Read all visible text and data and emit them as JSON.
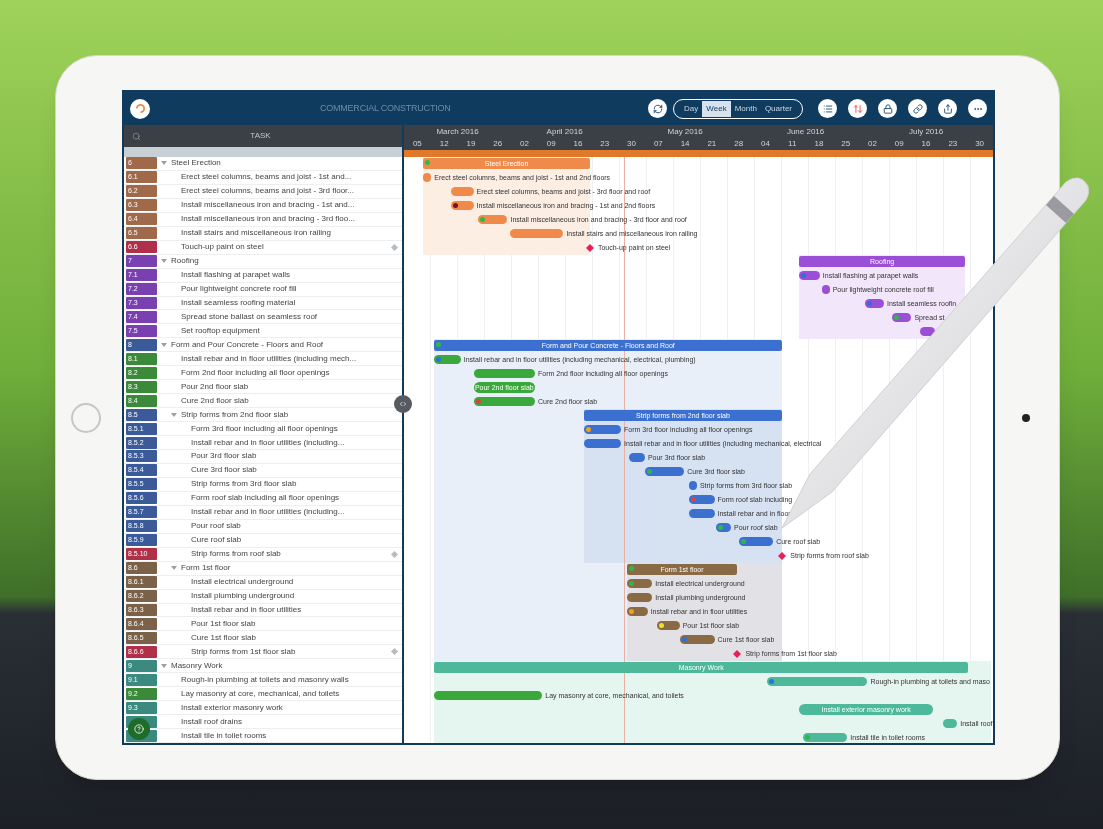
{
  "header": {
    "title": "COMMERCIAL CONSTRUCTION",
    "views": [
      {
        "label": "Day",
        "selected": false
      },
      {
        "label": "Week",
        "selected": true
      },
      {
        "label": "Month",
        "selected": false
      },
      {
        "label": "Quarter",
        "selected": false
      }
    ]
  },
  "task_panel": {
    "heading": "TASK"
  },
  "timeline": {
    "months": [
      "March 2016",
      "April 2016",
      "May 2016",
      "June 2016",
      "July 2016"
    ],
    "days": [
      "05",
      "12",
      "19",
      "26",
      "02",
      "09",
      "16",
      "23",
      "30",
      "07",
      "14",
      "21",
      "28",
      "04",
      "11",
      "18",
      "25",
      "02",
      "09",
      "16",
      "23",
      "30"
    ]
  },
  "tasks": [
    {
      "kind": "group",
      "code": "6",
      "name": "Steel Erection",
      "color": "#a0694a",
      "expanded": true,
      "children": [
        {
          "kind": "task",
          "code": "6.1",
          "name": "Erect steel columns, beams and joist - 1st and...",
          "color": "#a0694a"
        },
        {
          "kind": "task",
          "code": "6.2",
          "name": "Erect steel columns, beams and joist - 3rd floor...",
          "color": "#a0694a"
        },
        {
          "kind": "task",
          "code": "6.3",
          "name": "Install miscellaneous iron and bracing - 1st and...",
          "color": "#a0694a"
        },
        {
          "kind": "task",
          "code": "6.4",
          "name": "Install miscellaneous iron and bracing - 3rd floo...",
          "color": "#a0694a"
        },
        {
          "kind": "task",
          "code": "6.5",
          "name": "Install stairs and miscellaneous iron railing",
          "color": "#a0694a"
        },
        {
          "kind": "milestone",
          "code": "6.6",
          "name": "Touch-up paint on steel",
          "color": "#b0304a"
        }
      ]
    },
    {
      "kind": "group",
      "code": "7",
      "name": "Roofing",
      "color": "#7a3fb0",
      "expanded": true,
      "children": [
        {
          "kind": "task",
          "code": "7.1",
          "name": "Install flashing at parapet walls",
          "color": "#7a3fb0"
        },
        {
          "kind": "task",
          "code": "7.2",
          "name": "Pour lightweight concrete roof fill",
          "color": "#7a3fb0"
        },
        {
          "kind": "task",
          "code": "7.3",
          "name": "Install seamless roofing material",
          "color": "#7a3fb0"
        },
        {
          "kind": "task",
          "code": "7.4",
          "name": "Spread stone ballast on seamless roof",
          "color": "#7a3fb0"
        },
        {
          "kind": "task",
          "code": "7.5",
          "name": "Set rooftop equipment",
          "color": "#7a3fb0"
        }
      ]
    },
    {
      "kind": "group",
      "code": "8",
      "name": "Form and Pour Concrete - Floors and Roof",
      "color": "#3a5a9a",
      "expanded": true,
      "children": [
        {
          "kind": "task",
          "code": "8.1",
          "name": "Install rebar and in floor utilities (including mech...",
          "color": "#3a8a3a"
        },
        {
          "kind": "task",
          "code": "8.2",
          "name": "Form 2nd floor including all floor openings",
          "color": "#3a8a3a"
        },
        {
          "kind": "task",
          "code": "8.3",
          "name": "Pour 2nd floor slab",
          "color": "#3a8a3a"
        },
        {
          "kind": "task",
          "code": "8.4",
          "name": "Cure 2nd floor slab",
          "color": "#3a8a3a"
        },
        {
          "kind": "group",
          "code": "8.5",
          "name": "Strip forms from 2nd floor slab",
          "color": "#3a5a9a",
          "expanded": true,
          "children": [
            {
              "kind": "task",
              "code": "8.5.1",
              "name": "Form 3rd floor including all floor openings",
              "color": "#3a5a9a"
            },
            {
              "kind": "task",
              "code": "8.5.2",
              "name": "Install rebar and in floor utilities (including...",
              "color": "#3a5a9a"
            },
            {
              "kind": "task",
              "code": "8.5.3",
              "name": "Pour 3rd floor slab",
              "color": "#3a5a9a"
            },
            {
              "kind": "task",
              "code": "8.5.4",
              "name": "Cure 3rd floor slab",
              "color": "#3a5a9a"
            },
            {
              "kind": "task",
              "code": "8.5.5",
              "name": "Strip forms from 3rd floor slab",
              "color": "#3a5a9a"
            },
            {
              "kind": "task",
              "code": "8.5.6",
              "name": "Form roof slab including all floor openings",
              "color": "#3a5a9a"
            },
            {
              "kind": "task",
              "code": "8.5.7",
              "name": "Install rebar and in floor utilities (including...",
              "color": "#3a5a9a"
            },
            {
              "kind": "task",
              "code": "8.5.8",
              "name": "Pour roof slab",
              "color": "#3a5a9a"
            },
            {
              "kind": "task",
              "code": "8.5.9",
              "name": "Cure roof slab",
              "color": "#3a5a9a"
            },
            {
              "kind": "milestone",
              "code": "8.5.10",
              "name": "Strip forms from roof slab",
              "color": "#b0304a"
            }
          ]
        },
        {
          "kind": "group",
          "code": "8.6",
          "name": "Form 1st floor",
          "color": "#7a6148",
          "expanded": true,
          "children": [
            {
              "kind": "task",
              "code": "8.6.1",
              "name": "Install electrical underground",
              "color": "#7a6148"
            },
            {
              "kind": "task",
              "code": "8.6.2",
              "name": "Install plumbing underground",
              "color": "#7a6148"
            },
            {
              "kind": "task",
              "code": "8.6.3",
              "name": "Install rebar and in floor utilities",
              "color": "#7a6148"
            },
            {
              "kind": "task",
              "code": "8.6.4",
              "name": "Pour 1st floor slab",
              "color": "#7a6148"
            },
            {
              "kind": "task",
              "code": "8.6.5",
              "name": "Cure 1st floor slab",
              "color": "#7a6148"
            },
            {
              "kind": "milestone",
              "code": "8.6.6",
              "name": "Strip forms from 1st floor slab",
              "color": "#b0304a"
            }
          ]
        }
      ]
    },
    {
      "kind": "group",
      "code": "9",
      "name": "Masonry Work",
      "color": "#3a8a80",
      "expanded": true,
      "children": [
        {
          "kind": "task",
          "code": "9.1",
          "name": "Rough-in plumbing at toilets and masonry walls",
          "color": "#3a8a80"
        },
        {
          "kind": "task",
          "code": "9.2",
          "name": "Lay masonry at core, mechanical, and toilets",
          "color": "#3a8a3a"
        },
        {
          "kind": "task",
          "code": "9.3",
          "name": "Install exterior masonry work",
          "color": "#3a8a80"
        },
        {
          "kind": "task",
          "name": "Install roof drains",
          "color": "#3a8a80"
        },
        {
          "kind": "task",
          "name": "Install tile in toilet rooms",
          "color": "#3a8a80"
        }
      ]
    }
  ],
  "gantt_rows": [
    {
      "kind": "summary",
      "label": "Steel Erection",
      "color": "#f08a4b",
      "dot": {
        "color": "#2fb84a"
      }
    },
    {
      "kind": "task",
      "label": "Erect steel columns, beams and joist - 1st and 2nd floors",
      "color": "#f08a4b"
    },
    {
      "kind": "task",
      "label": "Erect steel columns, beams and joist - 3rd floor and roof",
      "color": "#f08a4b"
    },
    {
      "kind": "task",
      "label": "Install miscellaneous iron and bracing - 1st and 2nd floors",
      "color": "#f08a4b",
      "dot": {
        "color": "#7a1020"
      }
    },
    {
      "kind": "task",
      "label": "Install miscellaneous iron and bracing - 3rd floor and roof",
      "color": "#f08a4b",
      "dot": {
        "color": "#2fb84a"
      }
    },
    {
      "kind": "task",
      "label": "Install stairs and miscellaneous iron railing",
      "color": "#f08a4b"
    },
    {
      "kind": "milestone",
      "label": "Touch-up paint on steel",
      "color": "#e8205a"
    },
    {
      "kind": "summary",
      "label": "Roofing",
      "color": "#9b4fd6"
    },
    {
      "kind": "task",
      "label": "Install flashing at parapet walls",
      "color": "#9b4fd6",
      "dot": {
        "color": "#2f6fe0"
      }
    },
    {
      "kind": "task",
      "label": "Pour lightweight concrete roof fill",
      "color": "#9b4fd6"
    },
    {
      "kind": "task",
      "label": "Install seamless roofin",
      "color": "#9b4fd6",
      "dot": {
        "color": "#2f6fe0"
      }
    },
    {
      "kind": "task",
      "label": "Spread st",
      "color": "#9b4fd6",
      "dot": {
        "color": "#2fb84a"
      }
    },
    {
      "kind": "task",
      "color": "#9b4fd6"
    },
    {
      "kind": "summary",
      "label": "Form and Pour Concrete - Floors and Roof",
      "color": "#3b6fd0",
      "dot": {
        "color": "#2fb84a"
      }
    },
    {
      "kind": "task",
      "label": "Install rebar and in floor utilities (including mechanical, electrical, plumbing)",
      "color": "#3aa83a",
      "dot": {
        "color": "#2f6fe0"
      }
    },
    {
      "kind": "task",
      "label": "Form 2nd floor including all floor openings",
      "color": "#3aa83a"
    },
    {
      "kind": "inside",
      "label": "Pour 2nd floor slab",
      "color": "#3aa83a"
    },
    {
      "kind": "task",
      "label": "Cure 2nd floor slab",
      "color": "#3aa83a",
      "dot": {
        "color": "#e04040"
      }
    },
    {
      "kind": "summary",
      "label": "Strip forms from 2nd floor slab",
      "color": "#3b6fd0"
    },
    {
      "kind": "task",
      "label": "Form 3rd floor including all floor openings",
      "color": "#3b6fd0",
      "dot": {
        "color": "#f0a020"
      }
    },
    {
      "kind": "task",
      "label": "Install rebar and in floor utilities (including mechanical, electrical",
      "color": "#3b6fd0"
    },
    {
      "kind": "task",
      "label": "Pour 3rd floor slab",
      "color": "#3b6fd0"
    },
    {
      "kind": "task",
      "label": "Cure 3rd floor slab",
      "color": "#3b6fd0",
      "dot": {
        "color": "#2fb84a"
      }
    },
    {
      "kind": "task",
      "label": "Strip forms from 3rd floor slab",
      "color": "#3b6fd0"
    },
    {
      "kind": "task",
      "label": "Form roof slab including",
      "color": "#3b6fd0",
      "dot": {
        "color": "#e04040"
      }
    },
    {
      "kind": "task",
      "label": "Install rebar and in floor",
      "color": "#3b6fd0"
    },
    {
      "kind": "task",
      "label": "Pour roof slab",
      "color": "#3b6fd0",
      "dot": {
        "color": "#2fb84a"
      }
    },
    {
      "kind": "task",
      "label": "Cure roof slab",
      "color": "#3b6fd0",
      "dot": {
        "color": "#2fb84a"
      }
    },
    {
      "kind": "milestone",
      "label": "Strip forms from roof slab",
      "color": "#e8205a"
    },
    {
      "kind": "summary",
      "label": "Form 1st floor",
      "color": "#8a6a45",
      "dot": {
        "color": "#2fb84a"
      }
    },
    {
      "kind": "task",
      "label": "Install electrical underground",
      "color": "#8a6a45",
      "dot": {
        "color": "#2fb84a"
      }
    },
    {
      "kind": "task",
      "label": "Install plumbing underground",
      "color": "#8a6a45"
    },
    {
      "kind": "task",
      "label": "Install rebar and in floor utilities",
      "color": "#8a6a45",
      "dot": {
        "color": "#f0a020"
      }
    },
    {
      "kind": "task",
      "label": "Pour 1st floor slab",
      "color": "#8a6a45",
      "dot": {
        "color": "#f0e020"
      }
    },
    {
      "kind": "task",
      "label": "Cure 1st floor slab",
      "color": "#8a6a45",
      "dot": {
        "color": "#2f6fe0"
      }
    },
    {
      "kind": "milestone",
      "label": "Strip forms from 1st floor slab",
      "color": "#e8205a"
    },
    {
      "kind": "summary",
      "label": "Masonry Work",
      "color": "#4db89a"
    },
    {
      "kind": "task",
      "label": "Rough-in plumbing at toilets and maso",
      "color": "#4db89a",
      "dot": {
        "color": "#2f6fe0"
      }
    },
    {
      "kind": "task",
      "label": "Lay masonry at core, mechanical, and toilets",
      "color": "#3aa83a"
    },
    {
      "kind": "inside",
      "label": "Install exterior masonry work",
      "color": "#4db89a"
    },
    {
      "kind": "task",
      "label": "Install roof",
      "color": "#4db89a"
    },
    {
      "kind": "task",
      "label": "Install tile in toilet rooms",
      "color": "#4db89a",
      "dot": {
        "color": "#2fb84a"
      }
    }
  ]
}
